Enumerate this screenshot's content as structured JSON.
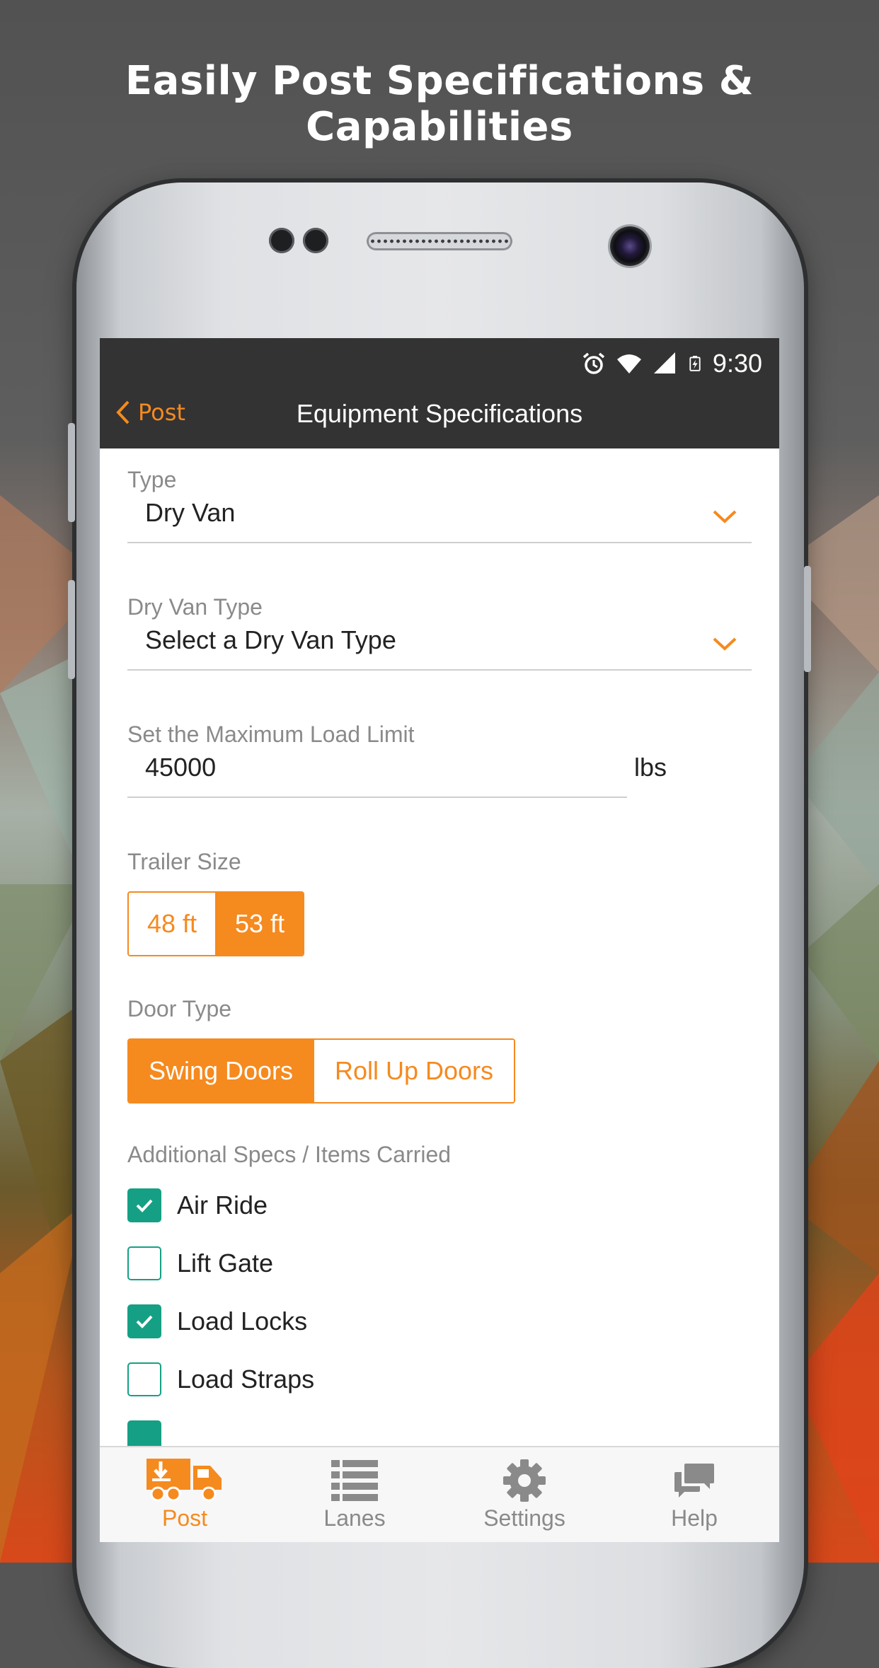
{
  "headline": "Easily Post Specifications & Capabilities",
  "colors": {
    "accent": "#f58a1f",
    "check": "#15a085",
    "topbar": "#333333"
  },
  "status_bar": {
    "time": "9:30",
    "icons": [
      "alarm-icon",
      "wifi-icon",
      "signal-icon",
      "battery-icon"
    ]
  },
  "nav": {
    "back_label": "Post",
    "title": "Equipment Specifications"
  },
  "form": {
    "type": {
      "label": "Type",
      "value": "Dry Van"
    },
    "dry_van_type": {
      "label": "Dry Van Type",
      "value": "Select a Dry Van Type"
    },
    "max_load": {
      "label": "Set the Maximum Load Limit",
      "value": "45000",
      "unit": "lbs"
    },
    "trailer_size": {
      "label": "Trailer Size",
      "options": [
        "48 ft",
        "53 ft"
      ],
      "selected": "53 ft"
    },
    "door_type": {
      "label": "Door Type",
      "options": [
        "Swing Doors",
        "Roll Up Doors"
      ],
      "selected": "Swing Doors"
    },
    "additional": {
      "label": "Additional Specs / Items Carried",
      "items": [
        {
          "label": "Air Ride",
          "checked": true
        },
        {
          "label": "Lift Gate",
          "checked": false
        },
        {
          "label": "Load Locks",
          "checked": true
        },
        {
          "label": "Load Straps",
          "checked": false
        }
      ]
    }
  },
  "tabs": [
    {
      "label": "Post",
      "icon": "truck-icon",
      "active": true
    },
    {
      "label": "Lanes",
      "icon": "list-icon",
      "active": false
    },
    {
      "label": "Settings",
      "icon": "gear-icon",
      "active": false
    },
    {
      "label": "Help",
      "icon": "chat-bubbles-icon",
      "active": false
    }
  ]
}
